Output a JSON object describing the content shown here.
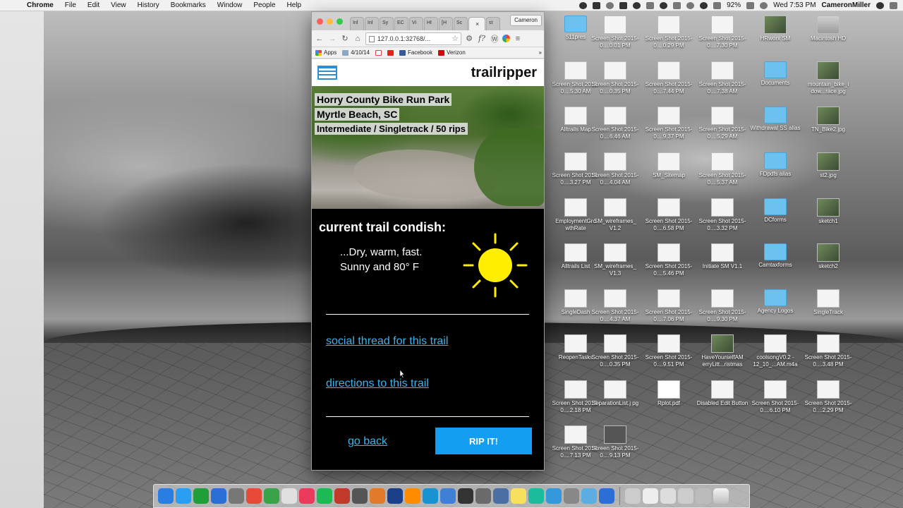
{
  "menubar": {
    "app": "Chrome",
    "items": [
      "File",
      "Edit",
      "View",
      "History",
      "Bookmarks",
      "Window",
      "People",
      "Help"
    ],
    "battery": "92%",
    "clock": "Wed 7:53 PM",
    "user": "CameronMiller"
  },
  "browser": {
    "tabs": [
      "Inl",
      "Inl",
      "Sy",
      "EC",
      "Vi",
      "HI",
      "[H",
      "Sc",
      "st"
    ],
    "profile": "Cameron",
    "address": "127.0.0.1:32768/...",
    "bookmarks": [
      {
        "label": "Apps",
        "icon": "apps-icon"
      },
      {
        "label": "4/10/14",
        "icon": "folder-icon"
      },
      {
        "label": "",
        "icon": "gmail-icon"
      },
      {
        "label": "",
        "icon": "youtube-icon"
      },
      {
        "label": "Facebook",
        "icon": "facebook-icon"
      },
      {
        "label": "Verizon",
        "icon": "verizon-icon"
      }
    ],
    "bookmarks_more": "»",
    "extensions": [
      "gear-icon",
      "function-icon",
      "wordpress-icon",
      "pinwheel-icon",
      "menu-icon"
    ]
  },
  "app": {
    "brand": "trailripper",
    "trail_name": "Horry County Bike Run Park",
    "location": "Myrtle Beach, SC",
    "details": "Intermediate / Singletrack / 50 rips",
    "condish_title": "current trail condish:",
    "condish_line1": "...Dry, warm, fast.",
    "condish_line2": "Sunny and 80° F",
    "weather_icon": "sun-icon",
    "social_link": "social thread for this trail",
    "directions_link": "directions to this trail",
    "back_label": "go back",
    "rip_label": "RIP IT!",
    "accent": "#139ef2",
    "link_color": "#3ab4ec",
    "sun_color": "#ffee00"
  },
  "desktop_icons": [
    {
      "label": "511pres",
      "type": "folder"
    },
    {
      "label": "Screen Shot 2015-0....0.01 PM",
      "type": "doc"
    },
    {
      "label": "Screen Shot 2015-0....0.29 PM",
      "type": "doc"
    },
    {
      "label": "Screen Shot 2015-0....7.30 PM",
      "type": "doc"
    },
    {
      "label": "HRworx SM",
      "type": "photo"
    },
    {
      "label": "Macintosh HD",
      "type": "hd"
    },
    {
      "label": "Screen Shot 2015-0....5.30 AM",
      "type": "doc"
    },
    {
      "label": "Screen Shot 2015-0....0.35 PM",
      "type": "doc"
    },
    {
      "label": "Screen Shot 2015-0....7.44 PM",
      "type": "doc"
    },
    {
      "label": "Screen Shot 2015-0....7.38 AM",
      "type": "doc"
    },
    {
      "label": "Documents",
      "type": "folder"
    },
    {
      "label": "mountain_bike_i dow...race.jpg",
      "type": "photo"
    },
    {
      "label": "Alltrails Map",
      "type": "doc"
    },
    {
      "label": "Screen Shot 2015-0....6.46 AM",
      "type": "doc"
    },
    {
      "label": "Screen Shot 2015-0....9.37 PM",
      "type": "doc"
    },
    {
      "label": "Screen Shot 2015-0....5.29 AM",
      "type": "doc"
    },
    {
      "label": "Withdrawal SS alias",
      "type": "folder"
    },
    {
      "label": "TN_Bike2.jpg",
      "type": "photo"
    },
    {
      "label": "Screen Shot 2015-0....3.27 PM",
      "type": "doc"
    },
    {
      "label": "Screen Shot 2015-0....4.04 AM",
      "type": "doc"
    },
    {
      "label": "SM_Sitemap",
      "type": "doc"
    },
    {
      "label": "Screen Shot 2015-0....5.37 AM",
      "type": "doc"
    },
    {
      "label": "FDpdfs alias",
      "type": "folder"
    },
    {
      "label": "st2.jpg",
      "type": "photo"
    },
    {
      "label": "EmploymentGro wthRate",
      "type": "doc"
    },
    {
      "label": "SM_wireframes_ V1.2",
      "type": "doc"
    },
    {
      "label": "Screen Shot 2015-0....6.58 PM",
      "type": "doc"
    },
    {
      "label": "Screen Shot 2015-0....3.32 PM",
      "type": "doc"
    },
    {
      "label": "DCforms",
      "type": "folder"
    },
    {
      "label": "sketch1",
      "type": "photo"
    },
    {
      "label": "Alltrails List",
      "type": "doc"
    },
    {
      "label": "SM_wireframes_ V1.3",
      "type": "doc"
    },
    {
      "label": "Screen Shot 2015-0....5.46 PM",
      "type": "doc"
    },
    {
      "label": "Initiate SM V1.1",
      "type": "doc"
    },
    {
      "label": "Camtaxforms",
      "type": "folder"
    },
    {
      "label": "sketch2",
      "type": "photo"
    },
    {
      "label": "SingleDash",
      "type": "doc"
    },
    {
      "label": "Screen Shot 2015-0....4.37 AM",
      "type": "doc"
    },
    {
      "label": "Screen Shot 2015-0....7.06 PM",
      "type": "doc"
    },
    {
      "label": "Screen Shot 2015-0....9.30 PM",
      "type": "doc"
    },
    {
      "label": "Agency Logos",
      "type": "folder"
    },
    {
      "label": "SingleTrack",
      "type": "doc"
    },
    {
      "label": "ReopenTasks",
      "type": "doc"
    },
    {
      "label": "Screen Shot 2015-0....0.35 PM",
      "type": "doc"
    },
    {
      "label": "Screen Shot 2015-0....9.51 PM",
      "type": "doc"
    },
    {
      "label": "HaveYourselfAM erryLitt...ristmas",
      "type": "photo"
    },
    {
      "label": "coolsongV0.2 - 12_10_...AM.m4a",
      "type": "doc"
    },
    {
      "label": "Screen Shot 2015-0....3.48 PM",
      "type": "doc"
    },
    {
      "label": "Screen Shot 2015-0....2.18 PM",
      "type": "doc"
    },
    {
      "label": "SeparationList.j pg",
      "type": "doc"
    },
    {
      "label": "Rplot.pdf",
      "type": "pdf"
    },
    {
      "label": "Disabled Edit Button",
      "type": "doc"
    },
    {
      "label": "Screen Shot 2015-0....6.10 PM",
      "type": "doc"
    },
    {
      "label": "Screen Shot 2015-0....2.29 PM",
      "type": "doc"
    },
    {
      "label": "Screen Shot 2015-0....7.13 PM",
      "type": "doc"
    },
    {
      "label": "Screen Shot 2015-0....9.13 PM",
      "type": "dark"
    }
  ],
  "dock_colors": [
    "#2a7de1",
    "#2a9ff2",
    "#1f9e3a",
    "#2b6fd6",
    "#777",
    "#e84a3a",
    "#3aa34a",
    "#e0e0e0",
    "#ea3b5c",
    "#1db954",
    "#c0392b",
    "#555",
    "#e07b2a",
    "#1c3f8a",
    "#ff8c00",
    "#1793d1",
    "#3f7fd6",
    "#333",
    "#6a6a6a",
    "#4a6fa5",
    "#f6e05e",
    "#1abc9c",
    "#3498db",
    "#888",
    "#5dade2",
    "#2b6fd6",
    "#ccc",
    "#eee",
    "#ddd",
    "#ccc",
    "#bbb"
  ]
}
